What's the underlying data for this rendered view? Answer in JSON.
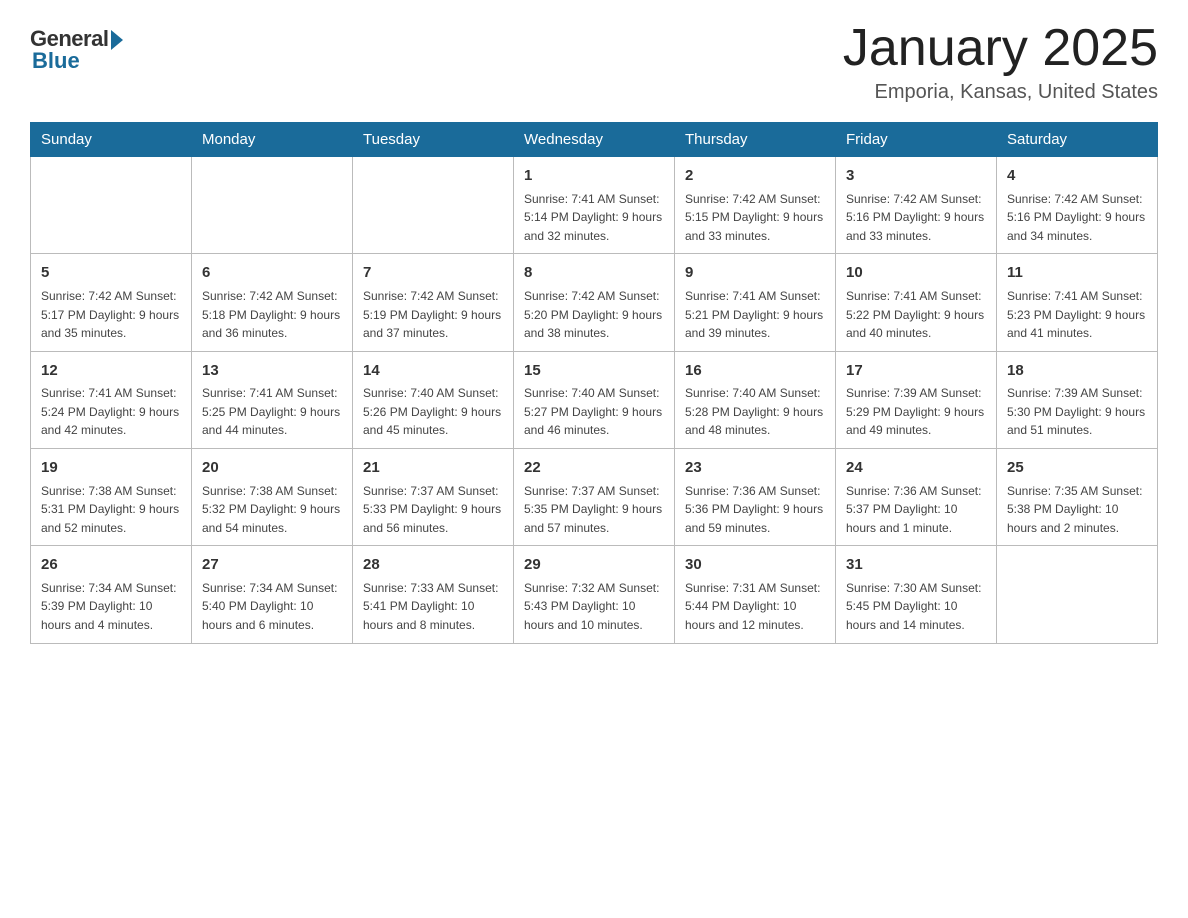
{
  "header": {
    "logo_general": "General",
    "logo_blue": "Blue",
    "month_title": "January 2025",
    "subtitle": "Emporia, Kansas, United States"
  },
  "days_of_week": [
    "Sunday",
    "Monday",
    "Tuesday",
    "Wednesday",
    "Thursday",
    "Friday",
    "Saturday"
  ],
  "weeks": [
    [
      {
        "day": "",
        "info": ""
      },
      {
        "day": "",
        "info": ""
      },
      {
        "day": "",
        "info": ""
      },
      {
        "day": "1",
        "info": "Sunrise: 7:41 AM\nSunset: 5:14 PM\nDaylight: 9 hours\nand 32 minutes."
      },
      {
        "day": "2",
        "info": "Sunrise: 7:42 AM\nSunset: 5:15 PM\nDaylight: 9 hours\nand 33 minutes."
      },
      {
        "day": "3",
        "info": "Sunrise: 7:42 AM\nSunset: 5:16 PM\nDaylight: 9 hours\nand 33 minutes."
      },
      {
        "day": "4",
        "info": "Sunrise: 7:42 AM\nSunset: 5:16 PM\nDaylight: 9 hours\nand 34 minutes."
      }
    ],
    [
      {
        "day": "5",
        "info": "Sunrise: 7:42 AM\nSunset: 5:17 PM\nDaylight: 9 hours\nand 35 minutes."
      },
      {
        "day": "6",
        "info": "Sunrise: 7:42 AM\nSunset: 5:18 PM\nDaylight: 9 hours\nand 36 minutes."
      },
      {
        "day": "7",
        "info": "Sunrise: 7:42 AM\nSunset: 5:19 PM\nDaylight: 9 hours\nand 37 minutes."
      },
      {
        "day": "8",
        "info": "Sunrise: 7:42 AM\nSunset: 5:20 PM\nDaylight: 9 hours\nand 38 minutes."
      },
      {
        "day": "9",
        "info": "Sunrise: 7:41 AM\nSunset: 5:21 PM\nDaylight: 9 hours\nand 39 minutes."
      },
      {
        "day": "10",
        "info": "Sunrise: 7:41 AM\nSunset: 5:22 PM\nDaylight: 9 hours\nand 40 minutes."
      },
      {
        "day": "11",
        "info": "Sunrise: 7:41 AM\nSunset: 5:23 PM\nDaylight: 9 hours\nand 41 minutes."
      }
    ],
    [
      {
        "day": "12",
        "info": "Sunrise: 7:41 AM\nSunset: 5:24 PM\nDaylight: 9 hours\nand 42 minutes."
      },
      {
        "day": "13",
        "info": "Sunrise: 7:41 AM\nSunset: 5:25 PM\nDaylight: 9 hours\nand 44 minutes."
      },
      {
        "day": "14",
        "info": "Sunrise: 7:40 AM\nSunset: 5:26 PM\nDaylight: 9 hours\nand 45 minutes."
      },
      {
        "day": "15",
        "info": "Sunrise: 7:40 AM\nSunset: 5:27 PM\nDaylight: 9 hours\nand 46 minutes."
      },
      {
        "day": "16",
        "info": "Sunrise: 7:40 AM\nSunset: 5:28 PM\nDaylight: 9 hours\nand 48 minutes."
      },
      {
        "day": "17",
        "info": "Sunrise: 7:39 AM\nSunset: 5:29 PM\nDaylight: 9 hours\nand 49 minutes."
      },
      {
        "day": "18",
        "info": "Sunrise: 7:39 AM\nSunset: 5:30 PM\nDaylight: 9 hours\nand 51 minutes."
      }
    ],
    [
      {
        "day": "19",
        "info": "Sunrise: 7:38 AM\nSunset: 5:31 PM\nDaylight: 9 hours\nand 52 minutes."
      },
      {
        "day": "20",
        "info": "Sunrise: 7:38 AM\nSunset: 5:32 PM\nDaylight: 9 hours\nand 54 minutes."
      },
      {
        "day": "21",
        "info": "Sunrise: 7:37 AM\nSunset: 5:33 PM\nDaylight: 9 hours\nand 56 minutes."
      },
      {
        "day": "22",
        "info": "Sunrise: 7:37 AM\nSunset: 5:35 PM\nDaylight: 9 hours\nand 57 minutes."
      },
      {
        "day": "23",
        "info": "Sunrise: 7:36 AM\nSunset: 5:36 PM\nDaylight: 9 hours\nand 59 minutes."
      },
      {
        "day": "24",
        "info": "Sunrise: 7:36 AM\nSunset: 5:37 PM\nDaylight: 10 hours\nand 1 minute."
      },
      {
        "day": "25",
        "info": "Sunrise: 7:35 AM\nSunset: 5:38 PM\nDaylight: 10 hours\nand 2 minutes."
      }
    ],
    [
      {
        "day": "26",
        "info": "Sunrise: 7:34 AM\nSunset: 5:39 PM\nDaylight: 10 hours\nand 4 minutes."
      },
      {
        "day": "27",
        "info": "Sunrise: 7:34 AM\nSunset: 5:40 PM\nDaylight: 10 hours\nand 6 minutes."
      },
      {
        "day": "28",
        "info": "Sunrise: 7:33 AM\nSunset: 5:41 PM\nDaylight: 10 hours\nand 8 minutes."
      },
      {
        "day": "29",
        "info": "Sunrise: 7:32 AM\nSunset: 5:43 PM\nDaylight: 10 hours\nand 10 minutes."
      },
      {
        "day": "30",
        "info": "Sunrise: 7:31 AM\nSunset: 5:44 PM\nDaylight: 10 hours\nand 12 minutes."
      },
      {
        "day": "31",
        "info": "Sunrise: 7:30 AM\nSunset: 5:45 PM\nDaylight: 10 hours\nand 14 minutes."
      },
      {
        "day": "",
        "info": ""
      }
    ]
  ]
}
